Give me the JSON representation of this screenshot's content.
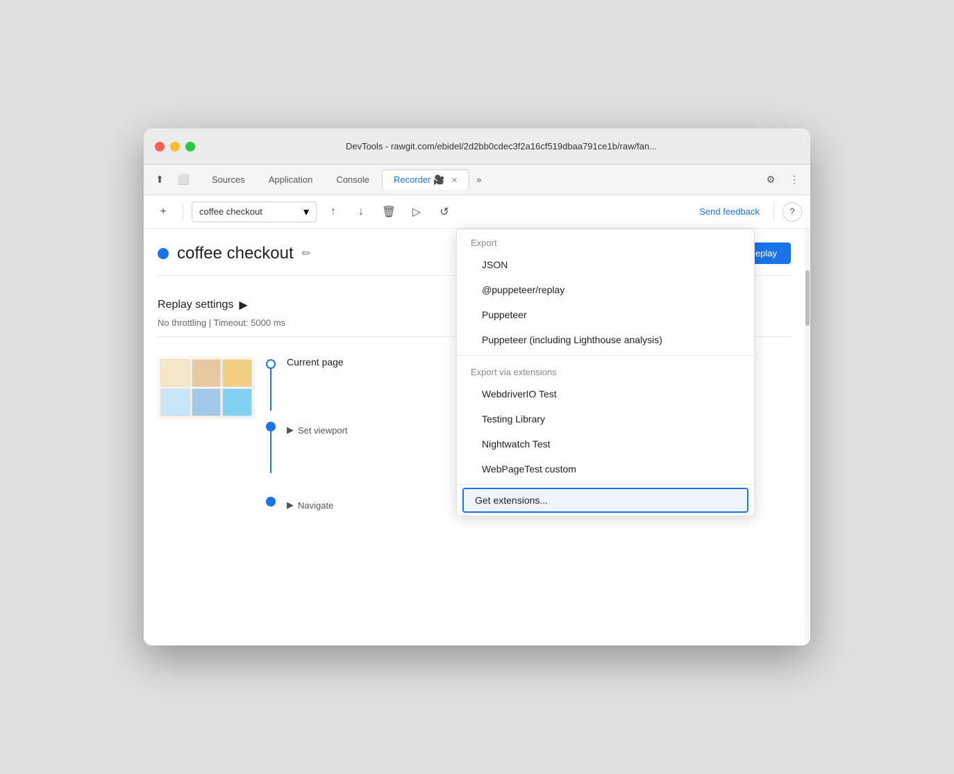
{
  "window": {
    "title": "DevTools - rawgit.com/ebidel/2d2bb0cdec3f2a16cf519dbaa791ce1b/raw/fan..."
  },
  "tabs": [
    {
      "label": "Sources",
      "active": false
    },
    {
      "label": "Application",
      "active": false
    },
    {
      "label": "Console",
      "active": false
    },
    {
      "label": "Recorder",
      "active": true
    },
    {
      "label": "»",
      "active": false
    }
  ],
  "toolbar": {
    "add_label": "+",
    "recording_name": "coffee checkout",
    "send_feedback": "Send feedback",
    "help_label": "?"
  },
  "recording": {
    "title": "coffee checkout",
    "edit_tooltip": "Edit name",
    "replay_label": "Replay"
  },
  "replay_settings": {
    "label": "Replay settings",
    "sub_label": "No throttling | Timeout: 5000 ms"
  },
  "steps": [
    {
      "label": "Current page",
      "has_thumbnail": true
    },
    {
      "label": "Set viewport",
      "expand": true
    },
    {
      "label": "Navigate",
      "expand": true
    }
  ],
  "dropdown": {
    "export_section": "Export",
    "items": [
      {
        "label": "JSON",
        "section": "export"
      },
      {
        "label": "@puppeteer/replay",
        "section": "export"
      },
      {
        "label": "Puppeteer",
        "section": "export"
      },
      {
        "label": "Puppeteer (including Lighthouse analysis)",
        "section": "export"
      }
    ],
    "via_extensions_section": "Export via extensions",
    "extension_items": [
      {
        "label": "WebdriverIO Test"
      },
      {
        "label": "Testing Library"
      },
      {
        "label": "Nightwatch Test"
      },
      {
        "label": "WebPageTest custom"
      }
    ],
    "get_extensions": "Get extensions..."
  }
}
